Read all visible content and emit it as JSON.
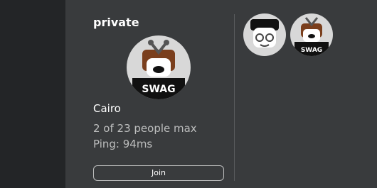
{
  "server": {
    "title": "private",
    "host_name": "Cairo",
    "capacity_text": "2 of 23 people max",
    "ping_text": "Ping: 94ms",
    "join_label": "Join"
  },
  "avatars": {
    "host": {
      "shirt_text": "SWAG",
      "icon": "swag-avatar-icon"
    },
    "players": [
      {
        "icon": "glasses-avatar-icon"
      },
      {
        "icon": "swag-avatar-icon",
        "shirt_text": "SWAG"
      }
    ]
  },
  "colors": {
    "background": "#393b3d",
    "left_strip": "#232527",
    "primary_text": "#ffffff",
    "secondary_text": "#bdbebe",
    "divider": "#5a5c5e",
    "avatar_bg": "#d8d8d8"
  }
}
